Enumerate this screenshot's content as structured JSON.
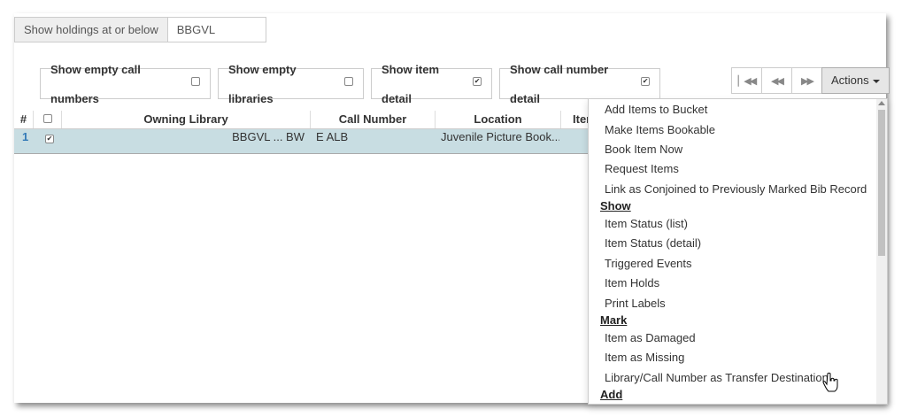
{
  "holdings": {
    "label": "Show holdings at or below",
    "value": "BBGVL"
  },
  "toggles": [
    {
      "label": "Show empty call numbers",
      "checked": false
    },
    {
      "label": "Show empty libraries",
      "checked": false
    },
    {
      "label": "Show item detail",
      "checked": true
    },
    {
      "label": "Show call number detail",
      "checked": true
    }
  ],
  "pager": {
    "actions_label": "Actions"
  },
  "grid": {
    "headers": [
      "#",
      "",
      "Owning Library",
      "Call Number",
      "Location",
      "Item"
    ],
    "rows": [
      {
        "index": "1",
        "checked": true,
        "library": "BBGVL ... BW",
        "call_number": "E ALB",
        "location": "Juvenile Picture Book..."
      }
    ]
  },
  "menu": {
    "items": [
      {
        "type": "item",
        "label": "Add Items to Bucket"
      },
      {
        "type": "item",
        "label": "Make Items Bookable"
      },
      {
        "type": "item",
        "label": "Book Item Now"
      },
      {
        "type": "item",
        "label": "Request Items"
      },
      {
        "type": "item",
        "label": "Link as Conjoined to Previously Marked Bib Record"
      },
      {
        "type": "header",
        "label": "Show"
      },
      {
        "type": "item",
        "label": "Item Status (list)"
      },
      {
        "type": "item",
        "label": "Item Status (detail)"
      },
      {
        "type": "item",
        "label": "Triggered Events"
      },
      {
        "type": "item",
        "label": "Item Holds"
      },
      {
        "type": "item",
        "label": "Print Labels"
      },
      {
        "type": "header",
        "label": "Mark"
      },
      {
        "type": "item",
        "label": "Item as Damaged"
      },
      {
        "type": "item",
        "label": "Item as Missing"
      },
      {
        "type": "item",
        "label": "Library/Call Number as Transfer Destination"
      },
      {
        "type": "header",
        "label": "Add"
      }
    ]
  }
}
